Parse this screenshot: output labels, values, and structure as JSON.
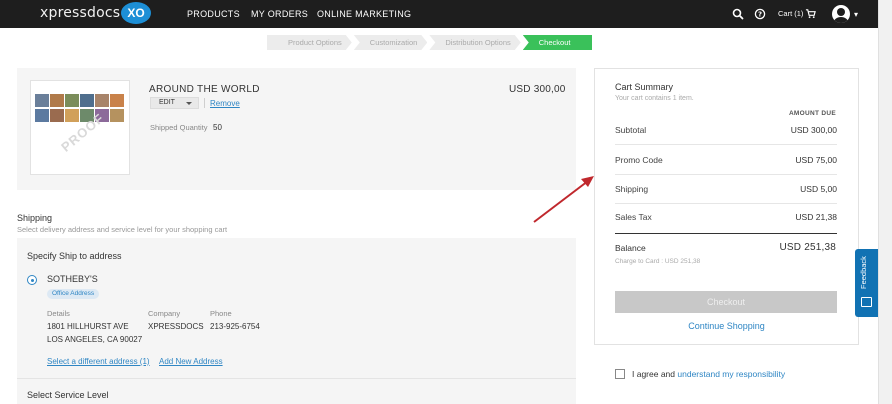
{
  "nav": {
    "logo": "xpressdocs",
    "logo_badge": "XO",
    "links": [
      "PRODUCTS",
      "MY ORDERS",
      "ONLINE MARKETING"
    ],
    "cart_label": "Cart (1)"
  },
  "steps": [
    "Product Options",
    "Customization",
    "Distribution Options",
    "Checkout"
  ],
  "product": {
    "title": "AROUND THE WORLD",
    "edit_label": "EDIT",
    "remove_label": "Remove",
    "shipped_quantity_label": "Shipped Quantity",
    "shipped_quantity": "50",
    "price": "USD 300,00",
    "watermark": "PROOF"
  },
  "shipping": {
    "heading": "Shipping",
    "subheading": "Select delivery address and service level for your shopping cart",
    "card_title": "Specify Ship to address",
    "address_name": "SOTHEBY'S",
    "address_badge": "Office Address",
    "details_label": "Details",
    "address_line1": "1801 HILLHURST AVE",
    "address_line2": "LOS ANGELES, CA 90027",
    "company_label": "Company",
    "company": "XPRESSDOCS",
    "phone_label": "Phone",
    "phone": "213-925-6754",
    "select_different": "Select a different address (1)",
    "add_new": "Add New Address",
    "service_level": "Select Service Level"
  },
  "summary": {
    "title": "Cart Summary",
    "subtitle": "Your cart contains 1 item.",
    "amount_due": "AMOUNT DUE",
    "rows": [
      {
        "label": "Subtotal",
        "value": "USD 300,00"
      },
      {
        "label": "Promo Code",
        "value": "USD 75,00"
      },
      {
        "label": "Shipping",
        "value": "USD 5,00"
      },
      {
        "label": "Sales Tax",
        "value": "USD 21,38"
      }
    ],
    "balance_label": "Balance",
    "balance_value": "USD 251,38",
    "charge_to": "Charge to Card : USD 251,38",
    "checkout_label": "Checkout",
    "continue_label": "Continue Shopping"
  },
  "agree": {
    "text": "I agree and",
    "link": "understand my responsibility"
  },
  "feedback_label": "Feedback",
  "colors": {
    "nav_bg": "#1e1e1e",
    "accent_blue": "#2f86c4",
    "logo_blue": "#1d8fd6",
    "step_active": "#3ac15a",
    "arrow_red": "#c0282d",
    "feedback_blue": "#1172b3"
  }
}
